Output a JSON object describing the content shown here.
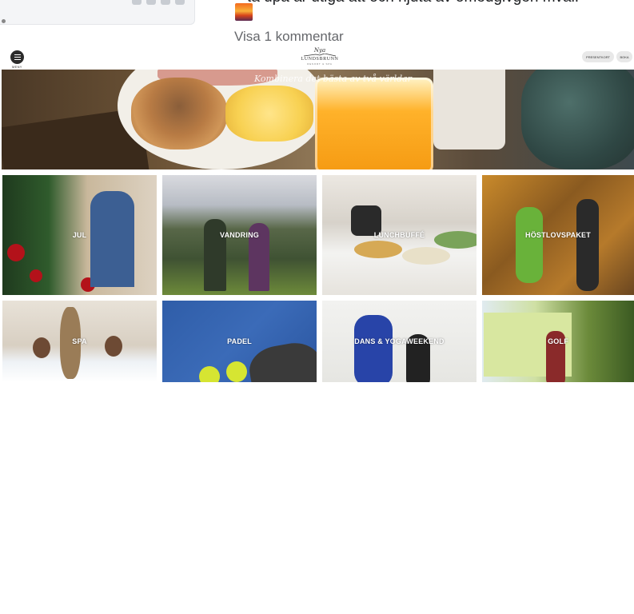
{
  "post": {
    "text_fragment": "ta upa ar utiga att och njuta av omedgivgen mval.",
    "comments_link": "Visa 1 kommentar"
  },
  "site": {
    "menu_label": "MENY",
    "logo_script": "Nya",
    "logo_name": "LUNDSBRUNN",
    "logo_sub": "RESORT & SPA",
    "nav_buttons": [
      "PRESENTKORT",
      "BOKA"
    ],
    "hero_caption": "Kombinera det bästa av två världar",
    "tiles": [
      {
        "label": "JUL"
      },
      {
        "label": "VANDRING"
      },
      {
        "label": "LUNCHBUFFÉ"
      },
      {
        "label": "HÖSTLOVSPAKET"
      },
      {
        "label": "SPA"
      },
      {
        "label": "PADEL"
      },
      {
        "label": "DANS & YOGAWEEKEND"
      },
      {
        "label": "GOLF"
      }
    ]
  },
  "colors": {
    "comment_link": "#65676b",
    "menu_button": "#2b2b2b",
    "pill": "#e8e8e8"
  },
  "icons": [
    "hamburger-menu-icon",
    "sunset-emoji-icon",
    "logo-mark-icon"
  ]
}
